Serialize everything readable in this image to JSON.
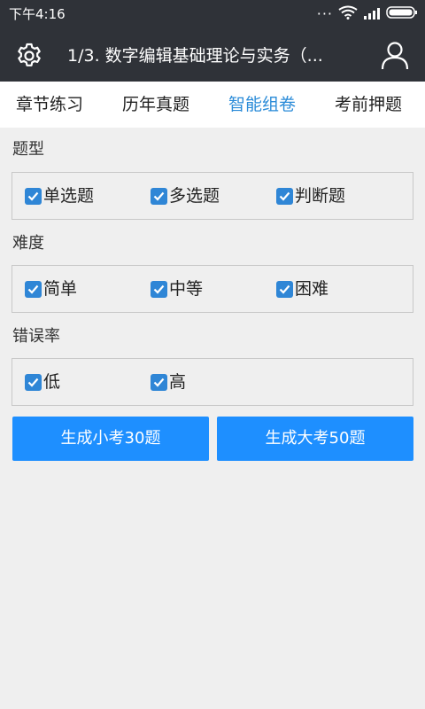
{
  "status_bar": {
    "time": "下午4:16",
    "more_icon": "dots-icon",
    "wifi_icon": "wifi-icon",
    "signal_icon": "signal-icon",
    "battery_icon": "battery-icon"
  },
  "app_bar": {
    "settings_icon": "gear-icon",
    "title": "1/3. 数字编辑基础理论与实务（...",
    "user_icon": "user-icon"
  },
  "tabs": [
    {
      "label": "章节练习",
      "active": false
    },
    {
      "label": "历年真题",
      "active": false
    },
    {
      "label": "智能组卷",
      "active": true
    },
    {
      "label": "考前押题",
      "active": false
    }
  ],
  "filters": {
    "type": {
      "title": "题型",
      "options": [
        {
          "label": "单选题",
          "checked": true
        },
        {
          "label": "多选题",
          "checked": true
        },
        {
          "label": "判断题",
          "checked": true
        }
      ]
    },
    "difficulty": {
      "title": "难度",
      "options": [
        {
          "label": "简单",
          "checked": true
        },
        {
          "label": "中等",
          "checked": true
        },
        {
          "label": "困难",
          "checked": true
        }
      ]
    },
    "error_rate": {
      "title": "错误率",
      "options": [
        {
          "label": "低",
          "checked": true
        },
        {
          "label": "高",
          "checked": true
        }
      ]
    }
  },
  "actions": {
    "small_exam_label": "生成小考30题",
    "big_exam_label": "生成大考50题"
  },
  "colors": {
    "bar": "#2f3238",
    "active_tab": "#2a8bd8",
    "checkbox": "#2f86d6",
    "button": "#1e8fff",
    "background": "#efefef"
  }
}
